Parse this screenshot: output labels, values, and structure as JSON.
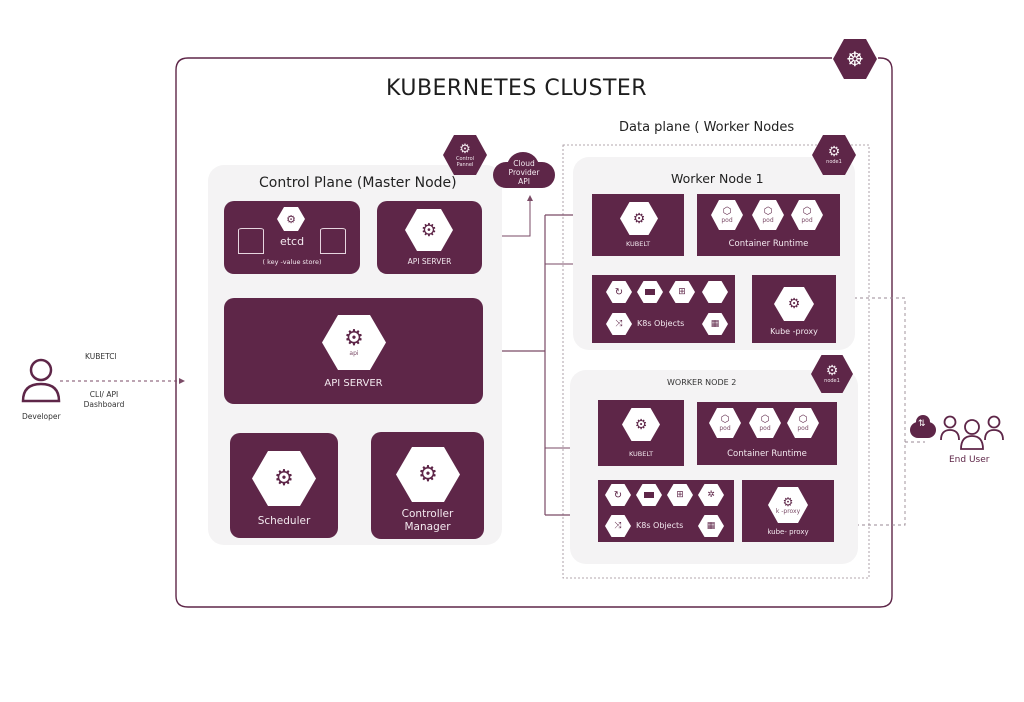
{
  "cluster": {
    "title": "KUBERNETES CLUSTER",
    "logo_icon": "kubernetes-helm-icon"
  },
  "control_plane": {
    "title": "Control Plane (Master Node)",
    "badge_label": "Control Pannel",
    "etcd": {
      "label": "etcd",
      "sublabel": "( key -value store)"
    },
    "api_server_top": {
      "label": "API SERVER"
    },
    "api_server_main": {
      "label": "API SERVER",
      "icon_label": "api"
    },
    "scheduler": {
      "label": "Scheduler"
    },
    "controller_manager": {
      "label_line1": "Controller",
      "label_line2": "Manager"
    }
  },
  "cloud_provider": {
    "line1": "Cloud",
    "line2": "Provider",
    "line3": "API"
  },
  "data_plane": {
    "title": "Data plane ( Worker Nodes",
    "worker_node_1": {
      "title": "Worker Node 1",
      "badge_label": "node1",
      "kubelet_label": "KUBELT",
      "container_runtime_label": "Container  Runtime",
      "pods": [
        "pod",
        "pod",
        "pod"
      ],
      "k8s_objects_label": "K8s Objects",
      "kube_proxy_label": "Kube -proxy"
    },
    "worker_node_2": {
      "title": "WORKER NODE 2",
      "badge_label": "node1",
      "kubelet_label": "KUBELT",
      "container_runtime_label": "Container  Runtime",
      "pods": [
        "pod",
        "pod",
        "pod"
      ],
      "k8s_objects_label": "K8s Objects",
      "kube_proxy_label": "kube- proxy",
      "kube_proxy_icon_label": "k -proxy"
    }
  },
  "developer": {
    "label": "Developer",
    "top_label": "KUBETCl",
    "bottom_label_line1": "CLI/ API",
    "bottom_label_line2": "Dashboard"
  },
  "end_user": {
    "label": "End User"
  },
  "colors": {
    "primary": "#5e2648",
    "panel": "#f4f3f4",
    "line": "#7a4a66"
  }
}
